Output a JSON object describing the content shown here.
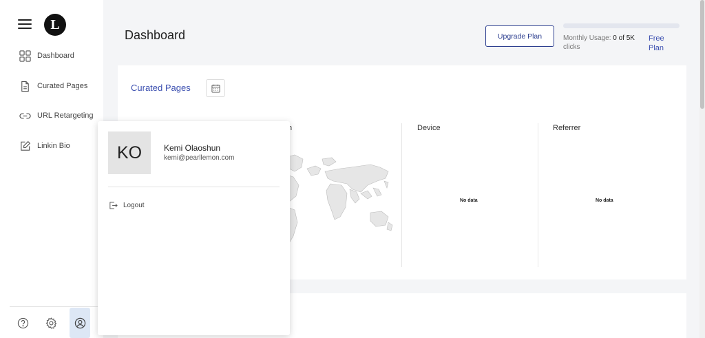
{
  "sidebar": {
    "logo_letter": "L",
    "items": [
      {
        "label": "Dashboard",
        "icon": "grid-icon"
      },
      {
        "label": "Curated Pages",
        "icon": "document-icon"
      },
      {
        "label": "URL Retargeting",
        "icon": "link-icon"
      },
      {
        "label": "Linkin Bio",
        "icon": "edit-icon"
      }
    ],
    "bottom_icons": [
      "help-icon",
      "gear-icon",
      "user-circle-icon"
    ]
  },
  "header": {
    "title": "Dashboard",
    "upgrade_label": "Upgrade Plan",
    "usage_label": "Monthly Usage:",
    "usage_value": "0 of 5K",
    "usage_unit": "clicks",
    "usage_fraction": 0,
    "plan_label": "Free Plan"
  },
  "card": {
    "title": "Curated Pages",
    "columns": [
      {
        "label": "n"
      },
      {
        "label": "Device",
        "empty": "No data"
      },
      {
        "label": "Referrer",
        "empty": "No data"
      }
    ]
  },
  "user_menu": {
    "initials": "KO",
    "name": "Kemi Olaoshun",
    "email": "kemi@pearllemon.com",
    "logout_label": "Logout"
  },
  "colors": {
    "accent": "#3b4fb0",
    "button_border": "#2c3e8f",
    "background": "#f4f5f7"
  }
}
